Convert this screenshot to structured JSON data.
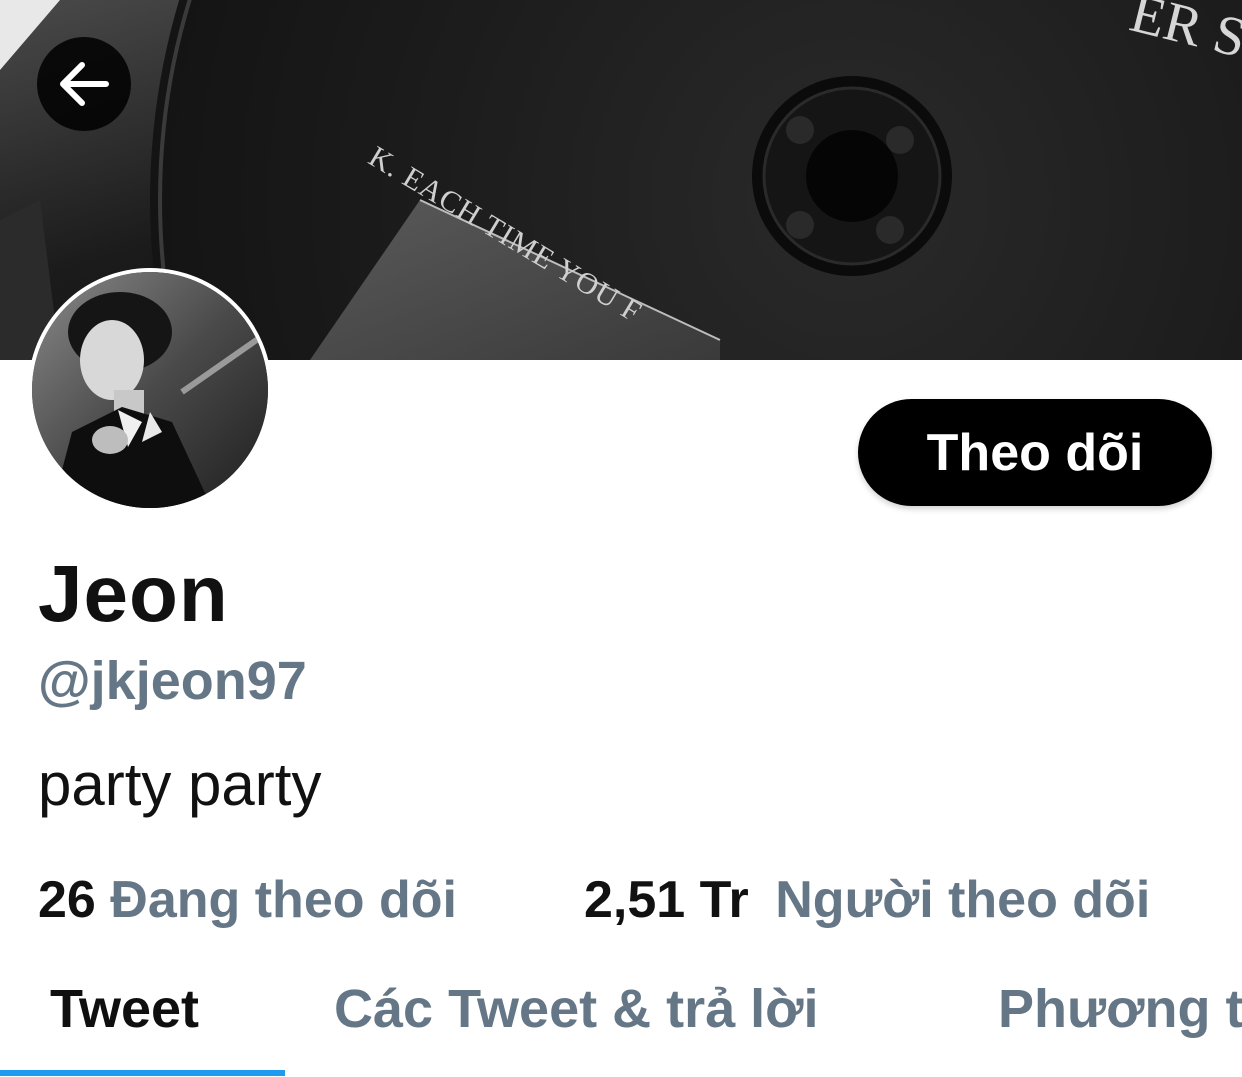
{
  "profile": {
    "display_name": "Jeon",
    "handle": "@jkjeon97",
    "bio": "party party",
    "follow_button_label": "Theo dõi"
  },
  "banner": {
    "album_text": "K.   EACH TIME YOU F",
    "corner_text": "ER S"
  },
  "stats": {
    "following_count": "26",
    "following_label": "Đang theo dõi",
    "followers_count": "2,51 Tr",
    "followers_label": "Người theo dõi"
  },
  "tabs": [
    {
      "label": "Tweet",
      "active": true
    },
    {
      "label": "Các Tweet & trả lời",
      "active": false
    },
    {
      "label": "Phương t",
      "active": false
    }
  ],
  "colors": {
    "accent": "#1d9bf0",
    "secondary_text": "#657786",
    "primary_text": "#111111",
    "button_bg": "#000000"
  },
  "icons": {
    "back": "arrow-left-icon"
  }
}
